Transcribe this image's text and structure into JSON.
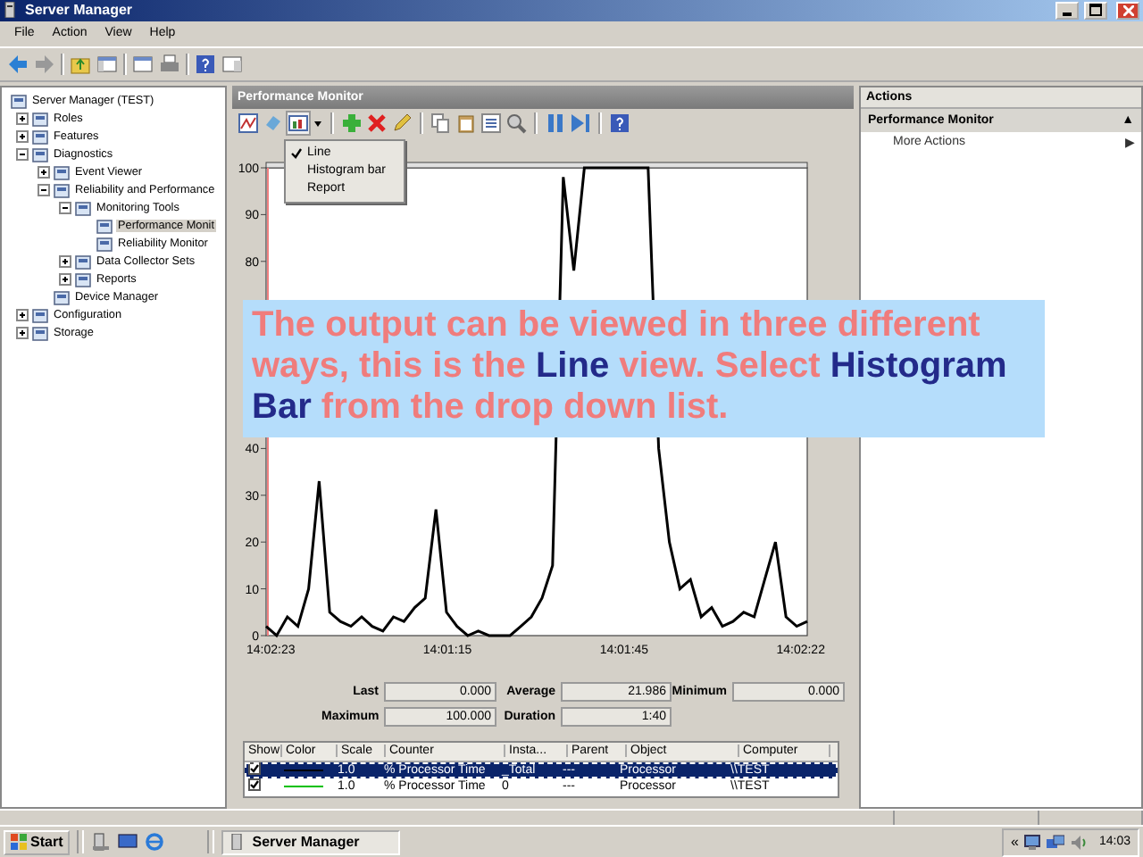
{
  "window": {
    "title": "Server Manager"
  },
  "menu": [
    {
      "label": "File"
    },
    {
      "label": "Action"
    },
    {
      "label": "View"
    },
    {
      "label": "Help"
    }
  ],
  "tree": [
    {
      "label": "Server Manager (TEST)",
      "selected": false,
      "children": [
        {
          "label": "Roles",
          "expanded": false,
          "selected": false
        },
        {
          "label": "Features",
          "expanded": false,
          "selected": false
        },
        {
          "label": "Diagnostics",
          "expanded": true,
          "selected": false,
          "children": [
            {
              "label": "Event Viewer",
              "expanded": false,
              "selected": false
            },
            {
              "label": "Reliability and Performance",
              "expanded": true,
              "selected": false,
              "children": [
                {
                  "label": "Monitoring Tools",
                  "expanded": true,
                  "selected": false,
                  "children": [
                    {
                      "label": "Performance Monit",
                      "selected": true
                    },
                    {
                      "label": "Reliability Monitor",
                      "selected": false
                    }
                  ]
                },
                {
                  "label": "Data Collector Sets",
                  "expanded": false,
                  "selected": false
                },
                {
                  "label": "Reports",
                  "expanded": false,
                  "selected": false
                }
              ]
            },
            {
              "label": "Device Manager",
              "selected": false
            }
          ]
        },
        {
          "label": "Configuration",
          "expanded": false,
          "selected": false
        },
        {
          "label": "Storage",
          "expanded": false,
          "selected": false
        }
      ]
    }
  ],
  "performance_panel": {
    "title": "Performance Monitor",
    "graph_type_menu": [
      {
        "label": "Line",
        "checked": true
      },
      {
        "label": "Histogram bar",
        "checked": false
      },
      {
        "label": "Report",
        "checked": false
      }
    ],
    "chart_data": {
      "type": "line",
      "ylim": [
        0,
        100
      ],
      "yticks": [
        0,
        10,
        20,
        30,
        40,
        80,
        90,
        100
      ],
      "series": [
        {
          "color": "#000000",
          "values": [
            2,
            0,
            4,
            2,
            10,
            33,
            5,
            3,
            2,
            4,
            2,
            1,
            4,
            3,
            6,
            8,
            27,
            5,
            2,
            0,
            1,
            0,
            0,
            0,
            2,
            4,
            8,
            15,
            98,
            78,
            100,
            100,
            100,
            100,
            100,
            100,
            100,
            40,
            20,
            10,
            12,
            4,
            6,
            2,
            3,
            5,
            4,
            12,
            20,
            4,
            2,
            3
          ]
        }
      ]
    },
    "time_labels": [
      "14:02:23",
      "14:01:15",
      "14:01:45",
      "14:02:22"
    ],
    "stats": [
      {
        "label": "Last",
        "value": "0.000"
      },
      {
        "label": "Average",
        "value": "21.986"
      },
      {
        "label": "Minimum",
        "value": "0.000"
      },
      {
        "label": "Maximum",
        "value": "100.000"
      },
      {
        "label": "Duration",
        "value": "1:40"
      }
    ],
    "counters": {
      "columns": [
        "Show",
        "Color",
        "Scale",
        "Counter",
        "Insta...",
        "Parent",
        "Object",
        "Computer"
      ],
      "rows": [
        {
          "show": true,
          "color": "#000000",
          "selected": true,
          "scale": "1.0",
          "counter": "% Processor Time",
          "instance": "_Total",
          "parent": "---",
          "object": "Processor",
          "computer": "\\\\TEST"
        },
        {
          "show": true,
          "color": "#00c000",
          "selected": false,
          "scale": "1.0",
          "counter": "% Processor Time",
          "instance": "0",
          "parent": "---",
          "object": "Processor",
          "computer": "\\\\TEST"
        }
      ]
    }
  },
  "callout": [
    {
      "text": "The output can be viewed in three different ways, this is the ",
      "highlight": false
    },
    {
      "text": "Line",
      "highlight": true
    },
    {
      "text": " view. Select ",
      "highlight": false
    },
    {
      "text": "Histogram Bar",
      "highlight": true
    },
    {
      "text": " from the drop down list.",
      "highlight": false
    }
  ],
  "actions": {
    "title": "Actions",
    "section": "Performance Monitor",
    "collapse_glyph": "▲",
    "items": [
      {
        "label": "More Actions",
        "glyph": "▶"
      }
    ]
  },
  "taskbar": {
    "start": "Start",
    "tasks": [
      {
        "label": "Server Manager",
        "selected": true
      }
    ],
    "tray_glyph": "«",
    "clock": "14:03"
  }
}
